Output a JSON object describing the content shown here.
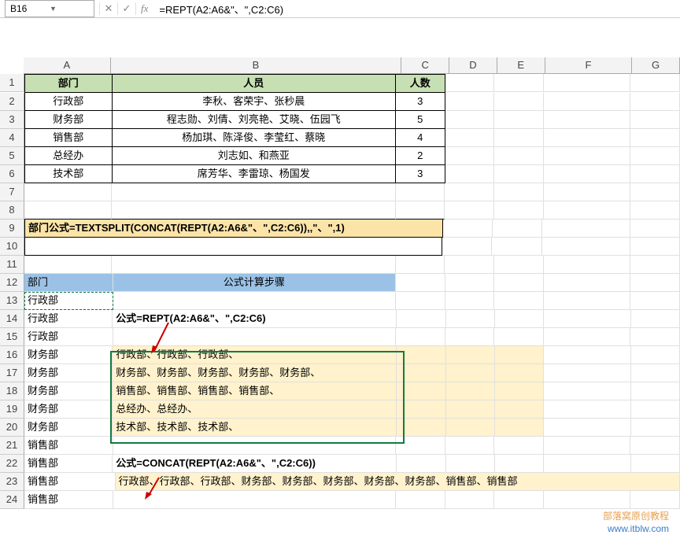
{
  "nameBox": "B16",
  "formulaBar": "=REPT(A2:A6&\"、\",C2:C6)",
  "cols": [
    "A",
    "B",
    "C",
    "D",
    "E",
    "F",
    "G"
  ],
  "widths": [
    110,
    370,
    60,
    60,
    60,
    110,
    60
  ],
  "hdr": {
    "dept": "部门",
    "pers": "人员",
    "cnt": "人数"
  },
  "t": [
    {
      "d": "行政部",
      "p": "李秋、客荣宇、张秒晨",
      "c": "3"
    },
    {
      "d": "财务部",
      "p": "程志勋、刘倩、刘亮艳、艾晓、伍园飞",
      "c": "5"
    },
    {
      "d": "销售部",
      "p": "杨加琪、陈泽俊、李莹红、蔡晓",
      "c": "4"
    },
    {
      "d": "总经办",
      "p": "刘志如、和燕亚",
      "c": "2"
    },
    {
      "d": "技术部",
      "p": "席芳华、李雷琼、杨国发",
      "c": "3"
    }
  ],
  "f9": "部门公式=TEXTSPLIT(CONCAT(REPT(A2:A6&\"、\",C2:C6)),,\"、\",1)",
  "a12": "部门",
  "b12": "公式计算步骤",
  "a13": "行政部",
  "a14": "行政部",
  "a15": "行政部",
  "a16": "财务部",
  "a17": "财务部",
  "a18": "财务部",
  "a19": "财务部",
  "a20": "财务部",
  "a21": "销售部",
  "a22": "销售部",
  "a23": "销售部",
  "a24": "销售部",
  "b14": "公式=REPT(A2:A6&\"、\",C2:C6)",
  "r16": "行政部、行政部、行政部、",
  "r17": "财务部、财务部、财务部、财务部、财务部、",
  "r18": "销售部、销售部、销售部、销售部、",
  "r19": "总经办、总经办、",
  "r20": "技术部、技术部、技术部、",
  "b22": "公式=CONCAT(REPT(A2:A6&\"、\",C2:C6))",
  "b23": "行政部、行政部、行政部、财务部、财务部、财务部、财务部、财务部、销售部、销售部",
  "wm1": "部落窝原创教程",
  "wm2": "www.itblw.com",
  "chart_data": null
}
